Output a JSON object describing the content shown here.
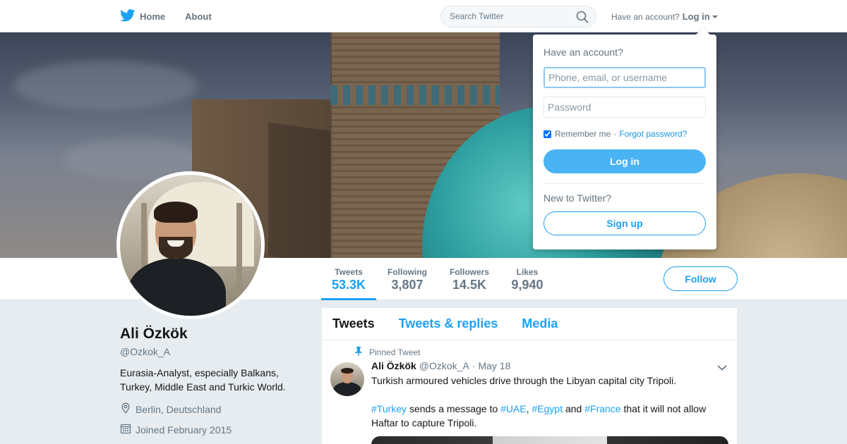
{
  "nav": {
    "home_label": "Home",
    "about_label": "About",
    "search_placeholder": "Search Twitter",
    "have_account_label": "Have an account?",
    "login_label": "Log in",
    "icons": [
      "twitter-logo-icon",
      "search-icon",
      "caret-down-icon"
    ],
    "brand_color": "#1da1f2"
  },
  "profile": {
    "name": "Ali Özkök",
    "handle": "@Ozkok_A",
    "bio": "Eurasia-Analyst, especially Balkans, Turkey, Middle East and Turkic World.",
    "location": "Berlin, Deutschland",
    "joined": "Joined February 2015",
    "stats": [
      {
        "label": "Tweets",
        "value": "53.3K",
        "active": true
      },
      {
        "label": "Following",
        "value": "3,807"
      },
      {
        "label": "Followers",
        "value": "14.5K"
      },
      {
        "label": "Likes",
        "value": "9,940"
      }
    ],
    "follow_label": "Follow"
  },
  "timeline": {
    "tabs": [
      {
        "label": "Tweets",
        "active": true
      },
      {
        "label": "Tweets & replies"
      },
      {
        "label": "Media"
      }
    ],
    "pinned_label": "Pinned Tweet",
    "tweet": {
      "name": "Ali Özkök",
      "handle": "@Ozkok_A",
      "separator": "·",
      "date": "May 18",
      "line1": "Turkish armoured vehicles drive through the Libyan capital city Tripoli.",
      "hashtag_turkey": "#Turkey",
      "text_a": " sends a message to ",
      "hashtag_uae": "#UAE",
      "comma": ", ",
      "hashtag_egypt": "#Egypt",
      "text_and": " and ",
      "hashtag_france": "#France",
      "text_b": " that it will not allow Haftar to capture Tripoli."
    }
  },
  "login_dropdown": {
    "title": "Have an account?",
    "username_placeholder": "Phone, email, or username",
    "password_placeholder": "Password",
    "remember_label": "Remember me",
    "separator": "·",
    "forgot_label": "Forgot password?",
    "login_button": "Log in",
    "new_label": "New to Twitter?",
    "signup_button": "Sign up",
    "remember_checked": true
  }
}
